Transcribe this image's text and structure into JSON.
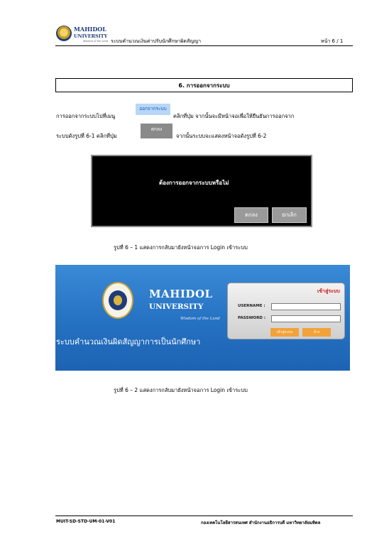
{
  "header": {
    "logo_name": "MAHIDOL",
    "logo_sub": "UNIVERSITY",
    "logo_motto": "Wisdom of the Land",
    "doc_title": "ระบบคำนวณเงินค่าปรับนักศึกษาผิดสัญญา",
    "page_num": "หน้า 6 / 1"
  },
  "section": {
    "title": "6.  การออกจากระบบ"
  },
  "body": {
    "para1_pre": "การออกจากระบบไปที่เมนู",
    "menu_chip": "ออกจากระบบ",
    "para1_post": "คลิกที่ปุ่ม จากนั้นจะมีหน้าจอเพื่อให้ยืนยันการออกจาก",
    "para2_pre": "ระบบดังรูปที่ 6-1 คลิกที่ปุ่ม",
    "ok_chip": "ตกลง",
    "para2_post": "จากนั้นระบบจะแสดงหน้าจอดังรูปที่ 6-2"
  },
  "figure1": {
    "message": "ต้องการออกจากระบบหรือไม่",
    "ok_button": "ตกลง",
    "cancel_button": "ยกเลิก",
    "caption": "รูปที่ 6 – 1 แสดงการกลับมายังหน้าจอการ Login เข้าระบบ"
  },
  "figure2": {
    "mu_line1": "MAHIDOL",
    "mu_line2": "UNIVERSITY",
    "mu_motto": "Wisdom of the Land",
    "banner": "ระบบคำนวณเงินผิดสัญญาการเป็นนักศึกษา",
    "panel_title": "เข้าสู่ระบบ",
    "username_label": "USERNAME :",
    "password_label": "PASSWORD :",
    "login_button": "เข้าสู่ระบบ",
    "clear_button": "ล้าง",
    "caption": "รูปที่ 6 – 2 แสดงการกลับมายังหน้าจอการ Login เข้าระบบ"
  },
  "footer": {
    "doc_code": "MUIT-SD-STD-UM-01-V01",
    "org": "กองเทคโนโลยีสารสนเทศ สำนักงานอธิการบดี มหาวิทยาลัยมหิดล"
  }
}
